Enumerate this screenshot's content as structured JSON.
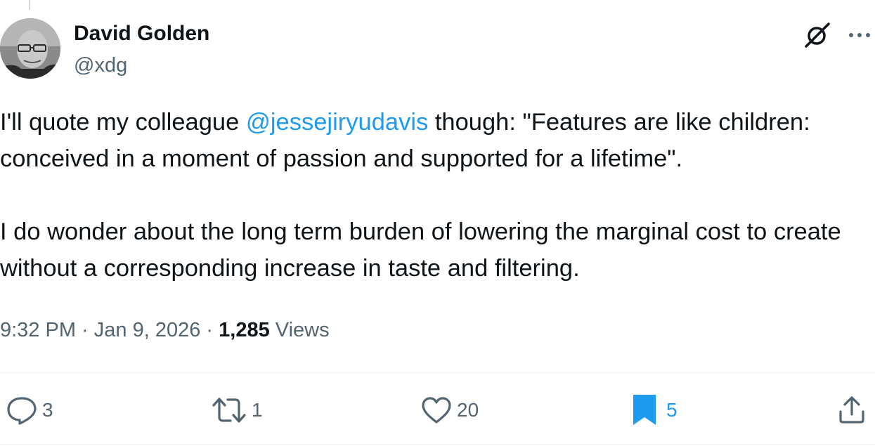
{
  "author": {
    "name": "David Golden",
    "handle": "@xdg"
  },
  "tweet": {
    "text_before_mention": "I'll quote my colleague ",
    "mention": "@jessejiryudavis",
    "text_after_mention": " though: \"Features are like children: conceived in a moment of passion and supported for a lifetime\".\n\nI do wonder about the long term burden of lowering the marginal cost to create without a corresponding increase in taste and filtering."
  },
  "meta": {
    "time": "9:32 PM",
    "separator": " · ",
    "date": "Jan 9, 2026",
    "views_count": "1,285",
    "views_label": " Views"
  },
  "actions": {
    "replies": "3",
    "reposts": "1",
    "likes": "20",
    "bookmarks": "5"
  },
  "icons": {
    "header": [
      "grok-icon",
      "more-icon"
    ],
    "actions": [
      "reply-icon",
      "retweet-icon",
      "heart-icon",
      "bookmark-icon",
      "share-icon"
    ]
  },
  "colors": {
    "text": "#0f1419",
    "secondary": "#536471",
    "accent": "#1d9bf0"
  }
}
